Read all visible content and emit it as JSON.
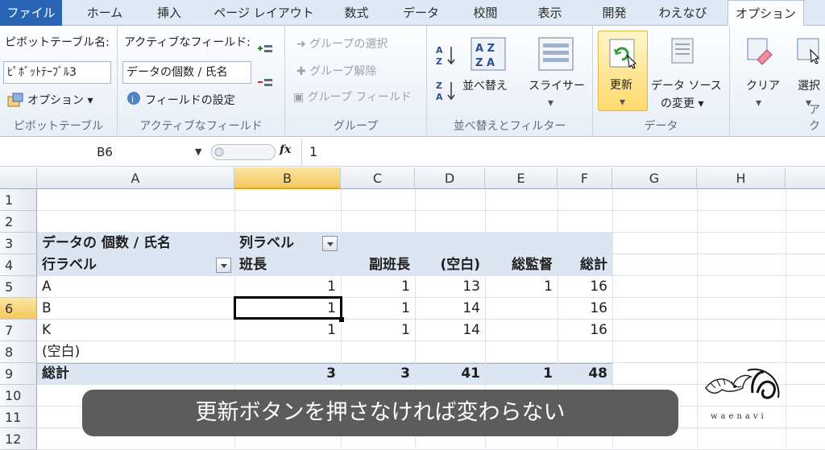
{
  "tabs": [
    "ファイル",
    "ホーム",
    "挿入",
    "ページ レイアウト",
    "数式",
    "データ",
    "校閲",
    "表示",
    "開発",
    "わえなび",
    "オプション"
  ],
  "ribbon": {
    "pivot_name_label": "ピボットテーブル名:",
    "pivot_name_value": "ﾋﾟﾎﾞｯﾄﾃｰﾌﾞﾙ3",
    "options_label": "オプション",
    "pivot_group": "ピボットテーブル",
    "active_field_label": "アクティブなフィールド:",
    "active_field_value": "データの個数 / 氏名",
    "field_settings": "フィールドの設定",
    "active_group": "アクティブなフィールド",
    "group_selection": "グループの選択",
    "ungroup": "グループ解除",
    "group_field": "グループ フィールド",
    "group_group": "グループ",
    "sort": "並べ替え",
    "slicer": "スライサー",
    "sort_group": "並べ替えとフィルター",
    "refresh": "更新",
    "change_source_1": "データ ソース",
    "change_source_2": "の変更",
    "data_group": "データ",
    "clear": "クリア",
    "select": "選択",
    "actions_group_partial": "アク"
  },
  "formula": {
    "name_box": "B6",
    "fx": "fx",
    "value": "1"
  },
  "columns": [
    "A",
    "B",
    "C",
    "D",
    "E",
    "F",
    "G",
    "H"
  ],
  "rows": [
    "1",
    "2",
    "3",
    "4",
    "5",
    "6",
    "7",
    "8",
    "9",
    "10",
    "11",
    "12"
  ],
  "pivot": {
    "r3_a": "データの 個数 / 氏名",
    "r3_b": "列ラベル",
    "r4_a": "行ラベル",
    "r4_b": "班長",
    "r4_c": "副班長",
    "r4_d": "(空白)",
    "r4_e": "総監督",
    "r4_f": "総計",
    "r5": [
      "A",
      "1",
      "1",
      "13",
      "1",
      "16"
    ],
    "r6": [
      "B",
      "1",
      "1",
      "14",
      "",
      "16"
    ],
    "r7": [
      "K",
      "1",
      "1",
      "14",
      "",
      "16"
    ],
    "r8_a": "(空白)",
    "r9": [
      "総計",
      "3",
      "3",
      "41",
      "1",
      "48"
    ]
  },
  "caption": "更新ボタンを押さなければ変わらない",
  "logo_text": "waenavi",
  "colors": {
    "file_tab": "#2a64b5",
    "pivot_band": "#dce6f2",
    "active_header": "#f5c85c"
  }
}
